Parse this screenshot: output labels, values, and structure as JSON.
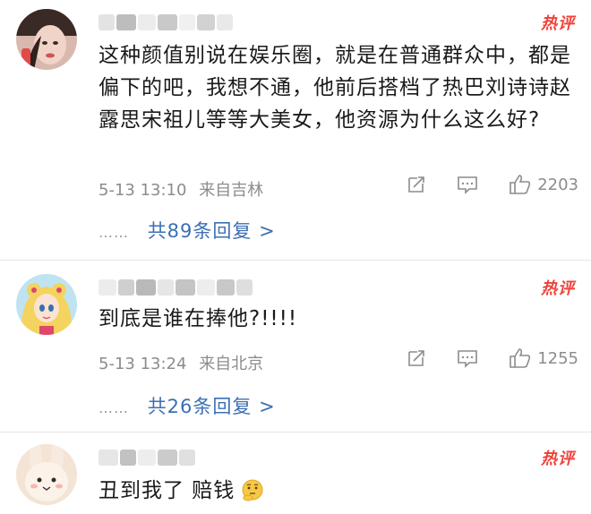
{
  "comments": [
    {
      "hot_label": "热评",
      "text": "这种颜值别说在娱乐圈，就是在普通群众中，都是偏下的吧，我想不通，他前后搭档了热巴刘诗诗赵露思宋祖儿等等大美女，他资源为什么这么好?",
      "time": "5-13 13:10",
      "location": "来自吉林",
      "likes": "2203",
      "replies_dots": "……",
      "replies_label": "共89条回复 >"
    },
    {
      "hot_label": "热评",
      "text": "到底是谁在捧他?!!!!",
      "time": "5-13 13:24",
      "location": "来自北京",
      "likes": "1255",
      "replies_dots": "……",
      "replies_label": "共26条回复 >"
    },
    {
      "hot_label": "热评",
      "text": "丑到我了 赔钱"
    }
  ],
  "icons": {
    "share": "share-icon",
    "comment": "comment-icon",
    "like": "thumbs-up-icon",
    "emoji": "thinking-emoji-icon"
  },
  "colors": {
    "hot": "#f0423b",
    "link": "#3c6fb4",
    "meta": "#8c8c8c"
  }
}
